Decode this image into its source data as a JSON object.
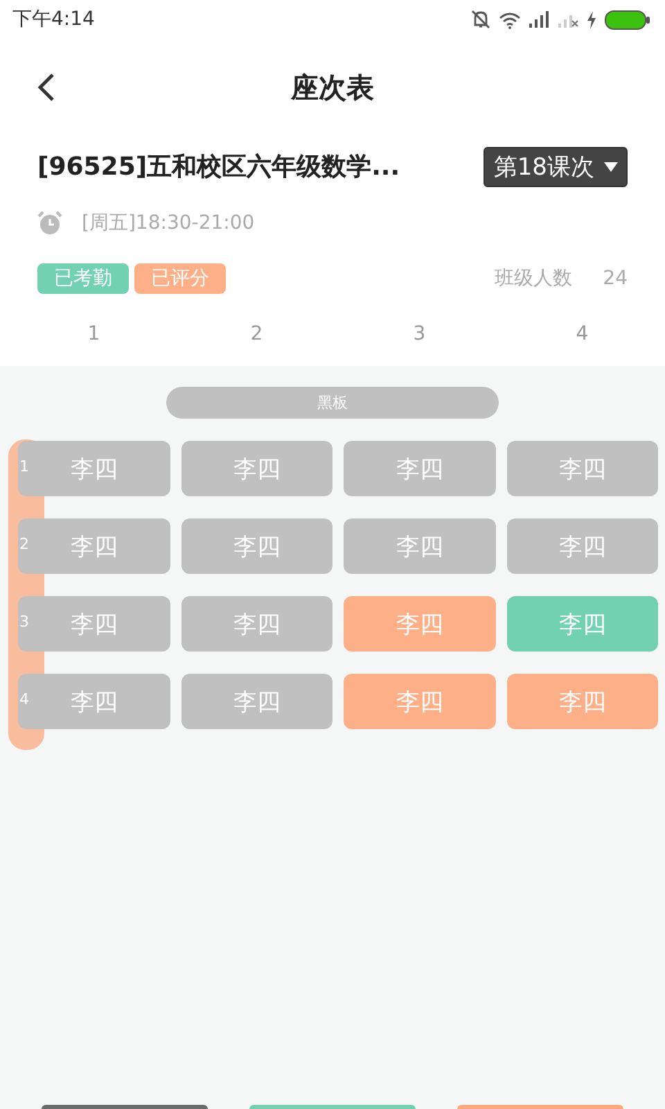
{
  "status_bar": {
    "time": "下午4:14"
  },
  "header": {
    "title": "座次表"
  },
  "course": {
    "title": "[96525]五和校区六年级数学...",
    "lesson": "第18课次",
    "time": "[周五]18:30-21:00"
  },
  "tags": [
    {
      "label": "已考勤",
      "color": "#72d1b0"
    },
    {
      "label": "已评分",
      "color": "#fdaf88"
    }
  ],
  "class_size": {
    "label": "班级人数",
    "value": "24"
  },
  "columns": [
    "1",
    "2",
    "3",
    "4"
  ],
  "blackboard": "黑板",
  "rows": [
    {
      "number": "1",
      "seats": [
        {
          "name": "李四",
          "kind": "plain"
        },
        {
          "name": "李四",
          "kind": "plain"
        },
        {
          "name": "李四",
          "kind": "plain"
        },
        {
          "name": "李四",
          "kind": "plain"
        }
      ]
    },
    {
      "number": "2",
      "seats": [
        {
          "name": "李四",
          "kind": "plain"
        },
        {
          "name": "李四",
          "kind": "plain"
        },
        {
          "name": "李四",
          "kind": "plain"
        },
        {
          "name": "李四",
          "kind": "plain"
        }
      ]
    },
    {
      "number": "3",
      "seats": [
        {
          "name": "李四",
          "kind": "plain"
        },
        {
          "name": "李四",
          "kind": "plain"
        },
        {
          "name": "李四",
          "kind": "scored"
        },
        {
          "name": "李四",
          "kind": "attended"
        }
      ]
    },
    {
      "number": "4",
      "seats": [
        {
          "name": "李四",
          "kind": "plain"
        },
        {
          "name": "李四",
          "kind": "plain"
        },
        {
          "name": "李四",
          "kind": "scored"
        },
        {
          "name": "李四",
          "kind": "scored"
        }
      ]
    }
  ],
  "bottom_buttons": [
    {
      "kind": "dark"
    },
    {
      "kind": "green"
    },
    {
      "kind": "orange"
    }
  ]
}
